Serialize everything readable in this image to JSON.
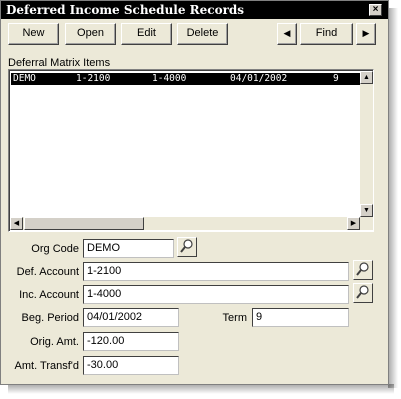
{
  "window": {
    "title": "Deferred Income Schedule Records",
    "close_glyph": "×"
  },
  "toolbar": {
    "new_label": "New",
    "open_label": "Open",
    "edit_label": "Edit",
    "delete_label": "Delete",
    "prev_glyph": "◀",
    "find_label": "Find",
    "next_glyph": "▶"
  },
  "list": {
    "label": "Deferral Matrix Items",
    "rows": [
      {
        "org": "DEMO",
        "def_account": "1-2100",
        "inc_account": "1-4000",
        "date": "04/01/2002",
        "term": "9"
      }
    ]
  },
  "form": {
    "org_code": {
      "label": "Org Code",
      "value": "DEMO"
    },
    "def_account": {
      "label": "Def. Account",
      "value": "1-2100"
    },
    "inc_account": {
      "label": "Inc. Account",
      "value": "1-4000"
    },
    "beg_period": {
      "label": "Beg. Period",
      "value": "04/01/2002"
    },
    "term": {
      "label": "Term",
      "value": "9"
    },
    "orig_amt": {
      "label": "Orig. Amt.",
      "value": "-120.00"
    },
    "amt_transfd": {
      "label": "Amt. Transf'd",
      "value": "-30.00"
    }
  },
  "icons": {
    "lookup": "magnifier-icon"
  }
}
